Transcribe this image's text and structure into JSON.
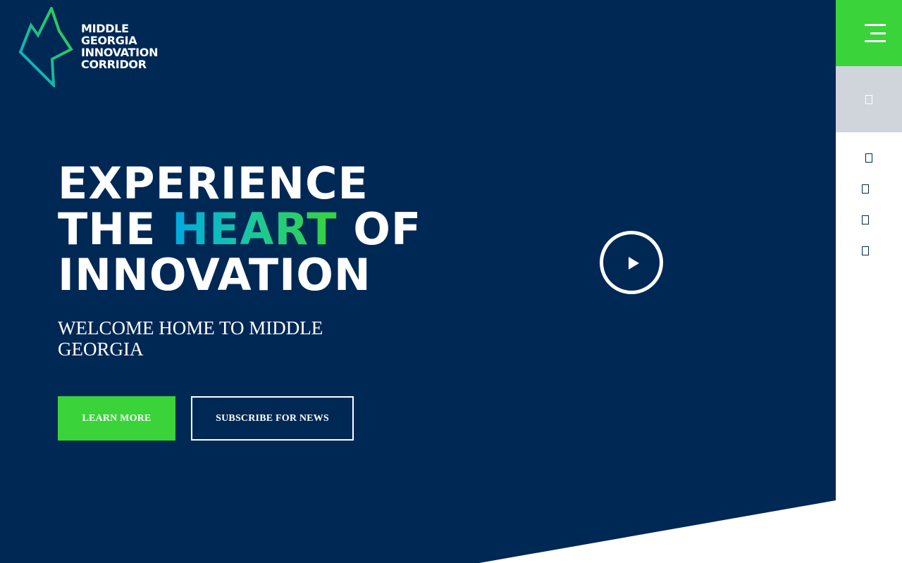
{
  "brand": {
    "logo_lines": [
      "MIDDLE",
      "GEORGIA",
      "INNOVATION",
      "CORRIDOR"
    ]
  },
  "hero": {
    "headline": {
      "line1": "EXPERIENCE",
      "line2_prefix": "THE ",
      "line2_highlight": "HEART",
      "line2_suffix": " OF",
      "line3": "INNOVATION"
    },
    "subheadline": "WELCOME HOME TO MIDDLE GEORGIA",
    "buttons": {
      "learn_more": "LEARN MORE",
      "subscribe": "SUBSCRIBE FOR NEWS"
    }
  },
  "sidebar": {
    "menu_icon": "hamburger-menu-icon",
    "search_icon": "search-icon",
    "social_icons": [
      "facebook-icon",
      "twitter-icon",
      "linkedin-icon",
      "instagram-icon"
    ]
  },
  "colors": {
    "navy": "#002855",
    "green": "#3ad339",
    "blue": "#00a9e0",
    "sidebar_gray": "#d0d5db"
  }
}
